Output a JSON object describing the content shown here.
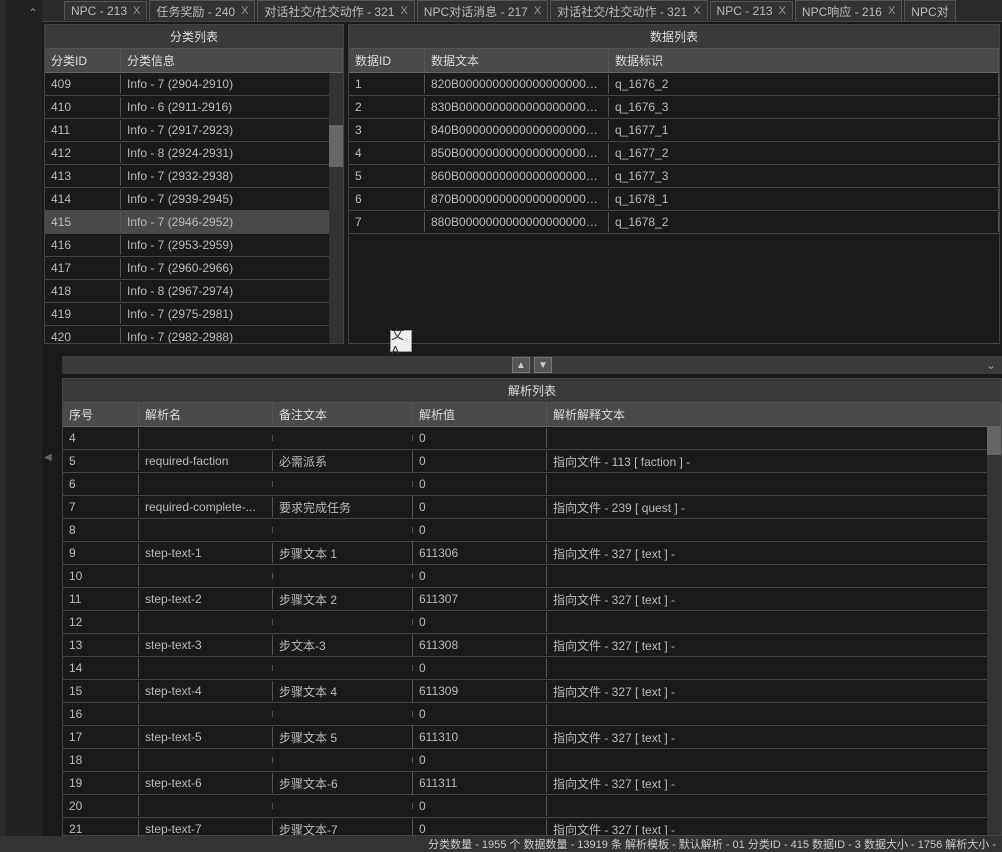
{
  "tabs": [
    "NPC - 213",
    "任务奖励 - 240",
    "对话社交/社交动作 - 321",
    "NPC对话消息 - 217",
    "对话社交/社交动作 - 321",
    "NPC - 213",
    "NPC响应 - 216",
    "NPC对"
  ],
  "category": {
    "title": "分类列表",
    "cols": [
      "分类ID",
      "分类信息"
    ],
    "rows": [
      {
        "id": "409",
        "info": "Info - 7 (2904-2910)"
      },
      {
        "id": "410",
        "info": "Info - 6 (2911-2916)"
      },
      {
        "id": "411",
        "info": "Info - 7 (2917-2923)"
      },
      {
        "id": "412",
        "info": "Info - 8 (2924-2931)"
      },
      {
        "id": "413",
        "info": "Info - 7 (2932-2938)"
      },
      {
        "id": "414",
        "info": "Info - 7 (2939-2945)"
      },
      {
        "id": "415",
        "info": "Info - 7 (2946-2952)",
        "sel": true
      },
      {
        "id": "416",
        "info": "Info - 7 (2953-2959)"
      },
      {
        "id": "417",
        "info": "Info - 7 (2960-2966)"
      },
      {
        "id": "418",
        "info": "Info - 8 (2967-2974)"
      },
      {
        "id": "419",
        "info": "Info - 7 (2975-2981)"
      },
      {
        "id": "420",
        "info": "Info - 7 (2982-2988)"
      }
    ]
  },
  "data": {
    "title": "数据列表",
    "cols": [
      "数据ID",
      "数据文本",
      "数据标识"
    ],
    "rows": [
      {
        "id": "1",
        "text": "820B000000000000000000000...",
        "tag": "q_1676_2"
      },
      {
        "id": "2",
        "text": "830B000000000000000000000...",
        "tag": "q_1676_3"
      },
      {
        "id": "3",
        "text": "840B000000000000000000000...",
        "tag": "q_1677_1"
      },
      {
        "id": "4",
        "text": "850B000000000000000000000...",
        "tag": "q_1677_2"
      },
      {
        "id": "5",
        "text": "860B000000000000000000000...",
        "tag": "q_1677_3"
      },
      {
        "id": "6",
        "text": "870B000000000000000000000...",
        "tag": "q_1678_1"
      },
      {
        "id": "7",
        "text": "880B000000000000000000000...",
        "tag": "q_1678_2"
      }
    ]
  },
  "parse": {
    "title": "解析列表",
    "cols": [
      "序号",
      "解析名",
      "备注文本",
      "解析值",
      "解析解释文本"
    ],
    "rows": [
      {
        "n": "4",
        "name": "",
        "note": "",
        "val": "0",
        "exp": ""
      },
      {
        "n": "5",
        "name": "required-faction",
        "note": "必需派系",
        "val": "0",
        "exp": "指向文件 - 113 [ faction ] -"
      },
      {
        "n": "6",
        "name": "",
        "note": "",
        "val": "0",
        "exp": ""
      },
      {
        "n": "7",
        "name": "required-complete-...",
        "note": "要求完成任务",
        "val": "0",
        "exp": "指向文件 - 239 [ quest ] -"
      },
      {
        "n": "8",
        "name": "",
        "note": "",
        "val": "0",
        "exp": ""
      },
      {
        "n": "9",
        "name": "step-text-1",
        "note": "步骤文本 1",
        "val": "611306",
        "exp": "指向文件 - 327 [ text ] -"
      },
      {
        "n": "10",
        "name": "",
        "note": "",
        "val": "0",
        "exp": ""
      },
      {
        "n": "11",
        "name": "step-text-2",
        "note": "步骤文本 2",
        "val": "611307",
        "exp": "指向文件 - 327 [ text ] -"
      },
      {
        "n": "12",
        "name": "",
        "note": "",
        "val": "0",
        "exp": ""
      },
      {
        "n": "13",
        "name": "step-text-3",
        "note": "步文本-3",
        "val": "611308",
        "exp": "指向文件 - 327 [ text ] -"
      },
      {
        "n": "14",
        "name": "",
        "note": "",
        "val": "0",
        "exp": ""
      },
      {
        "n": "15",
        "name": "step-text-4",
        "note": "步骤文本 4",
        "val": "611309",
        "exp": "指向文件 - 327 [ text ] -"
      },
      {
        "n": "16",
        "name": "",
        "note": "",
        "val": "0",
        "exp": ""
      },
      {
        "n": "17",
        "name": "step-text-5",
        "note": "步骤文本 5",
        "val": "611310",
        "exp": "指向文件 - 327 [ text ] -"
      },
      {
        "n": "18",
        "name": "",
        "note": "",
        "val": "0",
        "exp": ""
      },
      {
        "n": "19",
        "name": "step-text-6",
        "note": "步骤文本-6",
        "val": "611311",
        "exp": "指向文件 - 327 [ text ] -"
      },
      {
        "n": "20",
        "name": "",
        "note": "",
        "val": "0",
        "exp": ""
      },
      {
        "n": "21",
        "name": "step-text-7",
        "note": "步骤文本-7",
        "val": "0",
        "exp": "指向文件 - 327 [ text ] -"
      }
    ]
  },
  "status": "分类数量 - 1955 个 数据数量 - 13919 条 解析模板 - 默认解析 - 01 分类ID - 415 数据ID - 3 数据大小 - 1756 解析大小 -"
}
